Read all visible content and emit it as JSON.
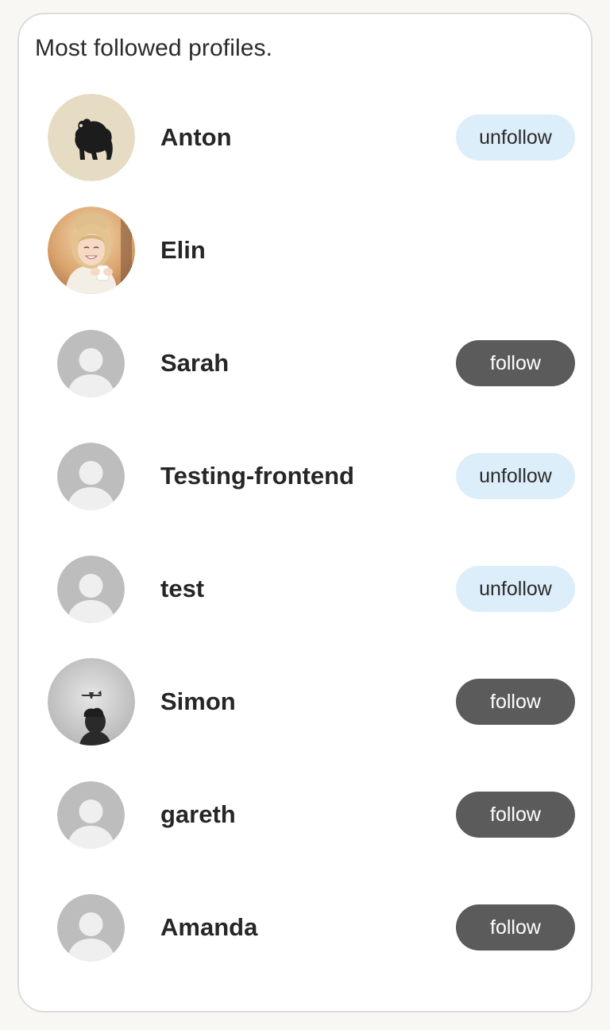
{
  "title": "Most followed profiles.",
  "profiles": [
    {
      "name": "Anton",
      "action": "unfollow"
    },
    {
      "name": "Elin",
      "action": ""
    },
    {
      "name": "Sarah",
      "action": "follow"
    },
    {
      "name": "Testing-frontend",
      "action": "unfollow"
    },
    {
      "name": "test",
      "action": "unfollow"
    },
    {
      "name": "Simon",
      "action": "follow"
    },
    {
      "name": "gareth",
      "action": "follow"
    },
    {
      "name": "Amanda",
      "action": "follow"
    }
  ],
  "colors": {
    "page_background": "#f8f7f3",
    "card_background": "#ffffff",
    "card_border": "#dcdcdc",
    "unfollow_button": "#ddeefb",
    "follow_button": "#5b5b5b",
    "follow_button_text": "#ffffff",
    "placeholder_avatar": "#bdbdbd"
  }
}
